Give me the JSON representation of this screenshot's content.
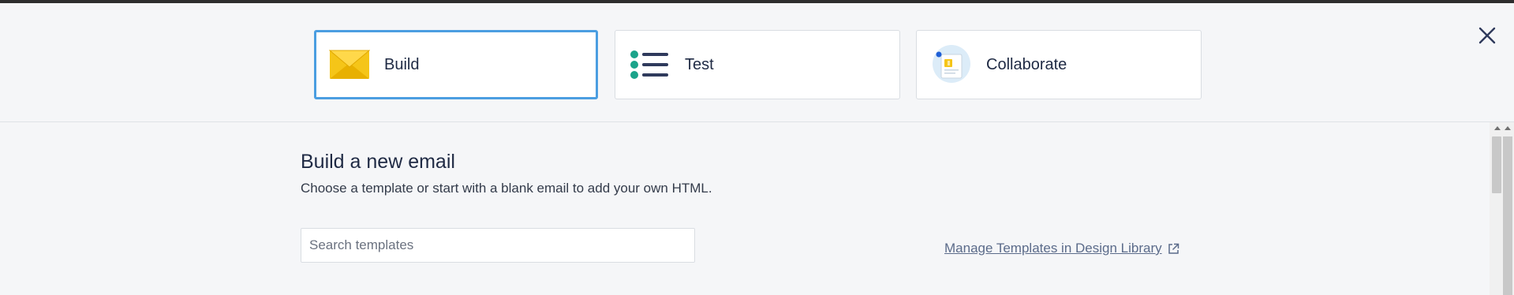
{
  "tabs": [
    {
      "label": "Build",
      "icon": "envelope-icon",
      "selected": true
    },
    {
      "label": "Test",
      "icon": "checklist-icon",
      "selected": false
    },
    {
      "label": "Collaborate",
      "icon": "collaborate-icon",
      "selected": false
    }
  ],
  "content": {
    "title": "Build a new email",
    "subtitle": "Choose a template or start with a blank email to add your own HTML.",
    "search": {
      "placeholder": "Search templates",
      "value": ""
    },
    "manage_link": "Manage Templates in Design Library"
  },
  "colors": {
    "accent": "#4b9ee1",
    "envelope": "#f5c518",
    "checklist_dots": "#1ba38a",
    "checklist_lines": "#2f3a5c"
  }
}
